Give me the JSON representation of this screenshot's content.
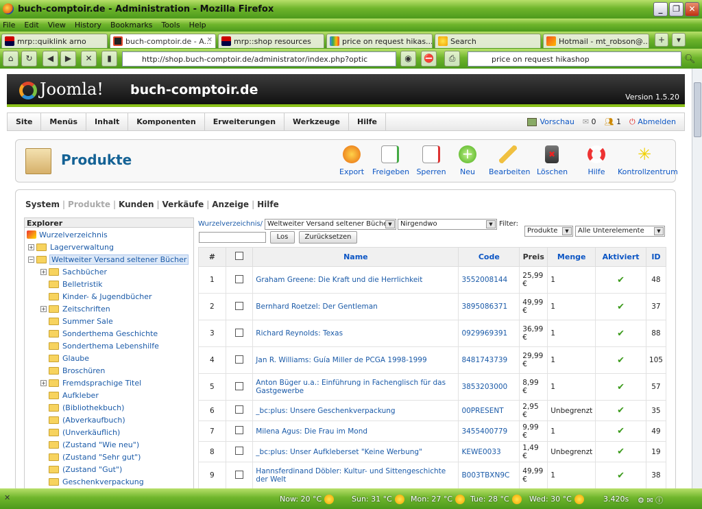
{
  "browser": {
    "window_title": "buch-comptoir.de - Administration - Mozilla Firefox",
    "menu": [
      "File",
      "Edit",
      "View",
      "History",
      "Bookmarks",
      "Tools",
      "Help"
    ],
    "tabs": [
      {
        "label": "mrp::quiklink arno"
      },
      {
        "label": "buch-comptoir.de - A..."
      },
      {
        "label": "mrp::shop resources"
      },
      {
        "label": "price on request hikas..."
      },
      {
        "label": "Search"
      },
      {
        "label": "Hotmail - mt_robson@..."
      }
    ],
    "url": "http://shop.buch-comptoir.de/administrator/index.php?optic",
    "search_text": "price on request hikashop"
  },
  "joomla": {
    "logo_text": "Joomla!",
    "site_name": "buch-comptoir.de",
    "version": "Version 1.5.20",
    "menu": [
      "Site",
      "Menüs",
      "Inhalt",
      "Komponenten",
      "Erweiterungen",
      "Werkzeuge",
      "Hilfe"
    ],
    "right": {
      "preview": "Vorschau",
      "messages": "0",
      "users": "1",
      "logout": "Abmelden"
    }
  },
  "toolbar": {
    "title": "Produkte",
    "buttons": [
      "Export",
      "Freigeben",
      "Sperren",
      "Neu",
      "Bearbeiten",
      "Löschen",
      "Hilfe",
      "Kontrollzentrum"
    ]
  },
  "submenu": [
    "System",
    "Produkte",
    "Kunden",
    "Verkäufe",
    "Anzeige",
    "Hilfe"
  ],
  "explorer": {
    "header": "Explorer",
    "root": "Wurzelverzeichnis",
    "items": [
      {
        "label": "Lagerverwaltung"
      },
      {
        "label": "Weltweiter Versand seltener Bücher"
      },
      {
        "label": "Sachbücher"
      },
      {
        "label": "Belletristik"
      },
      {
        "label": "Kinder- & Jugendbücher"
      },
      {
        "label": "Zeitschriften"
      },
      {
        "label": "Summer Sale"
      },
      {
        "label": "Sonderthema Geschichte"
      },
      {
        "label": "Sonderthema Lebenshilfe"
      },
      {
        "label": "Glaube"
      },
      {
        "label": "Broschüren"
      },
      {
        "label": "Fremdsprachige Titel"
      },
      {
        "label": "Aufkleber"
      },
      {
        "label": "(Bibliothekbuch)"
      },
      {
        "label": "(Abverkaufbuch)"
      },
      {
        "label": "(Unverkäuflich)"
      },
      {
        "label": "(Zustand \"Wie neu\")"
      },
      {
        "label": "(Zustand \"Sehr gut\")"
      },
      {
        "label": "(Zustand \"Gut\")"
      },
      {
        "label": "Geschenkverpackung"
      }
    ]
  },
  "filters": {
    "breadcrumb": "Wurzelverzeichnis/",
    "category_select": "Weltweiter Versand seltener Bücher",
    "location_select": "Nirgendwo",
    "filter_label": "Filter:",
    "type_select": "Produkte",
    "scope_select": "Alle Unterelemente",
    "search_value": "",
    "go_button": "Los",
    "reset_button": "Zurücksetzen"
  },
  "table": {
    "headers": [
      "#",
      "",
      "Name",
      "Code",
      "Preis",
      "Menge",
      "Aktiviert",
      "ID"
    ],
    "rows": [
      {
        "num": "1",
        "name": "Graham Greene: Die Kraft und die Herrlichkeit",
        "code": "3552008144",
        "price": "25,99 €",
        "qty": "1",
        "id": "48"
      },
      {
        "num": "2",
        "name": "Bernhard Roetzel: Der Gentleman",
        "code": "3895086371",
        "price": "49,99 €",
        "qty": "1",
        "id": "37"
      },
      {
        "num": "3",
        "name": "Richard Reynolds: Texas",
        "code": "0929969391",
        "price": "36,99 €",
        "qty": "1",
        "id": "88"
      },
      {
        "num": "4",
        "name": "Jan R. Williams: Guía Miller de PCGA 1998-1999",
        "code": "8481743739",
        "price": "29,99 €",
        "qty": "1",
        "id": "105"
      },
      {
        "num": "5",
        "name": "Anton Büger u.a.: Einführung in Fachenglisch für das Gastgewerbe",
        "code": "3853203000",
        "price": "8,99 €",
        "qty": "1",
        "id": "57"
      },
      {
        "num": "6",
        "name": "_bc:plus: Unsere Geschenkverpackung",
        "code": "00PRESENT",
        "price": "2,95 €",
        "qty": "Unbegrenzt",
        "id": "35"
      },
      {
        "num": "7",
        "name": "Milena Agus: Die Frau im Mond",
        "code": "3455400779",
        "price": "9,99 €",
        "qty": "1",
        "id": "49"
      },
      {
        "num": "8",
        "name": "_bc:plus: Unser Aufkleberset \"Keine Werbung\"",
        "code": "KEWE0033",
        "price": "1,49 €",
        "qty": "Unbegrenzt",
        "id": "19"
      },
      {
        "num": "9",
        "name": "Hannsferdinand Döbler: Kultur- und Sittengeschichte der Welt",
        "code": "B003TBXN9C",
        "price": "49,99 €",
        "qty": "1",
        "id": "38"
      }
    ]
  },
  "statusbar": {
    "weather": [
      "Now: 20 °C",
      "Sun: 31 °C",
      "Mon: 27 °C",
      "Tue: 28 °C",
      "Wed: 30 °C"
    ],
    "timer": "3.420s"
  },
  "colors": {
    "accent": "#146295",
    "link": "#0b55c4",
    "joomla_green": "#8bc11a",
    "enabled_tick": "#3a9a1a"
  }
}
